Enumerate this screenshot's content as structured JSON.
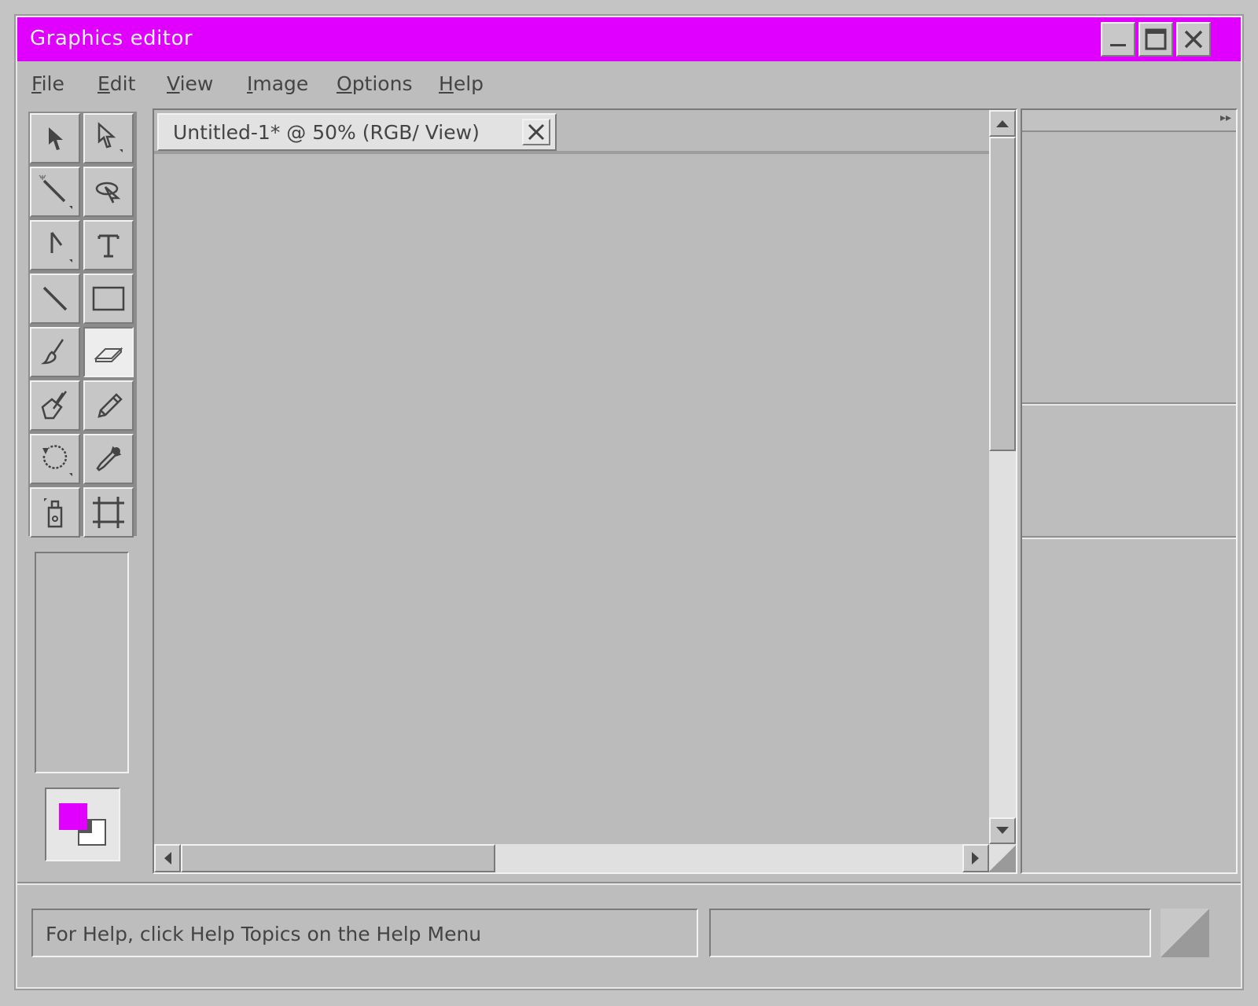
{
  "window": {
    "title": "Graphics editor",
    "title_bar_color": "#df00ff",
    "controls": [
      "minimize-icon",
      "maximize-icon",
      "close-icon"
    ]
  },
  "menu": {
    "items": [
      {
        "accel": "F",
        "rest": "ile"
      },
      {
        "accel": "E",
        "rest": "dit"
      },
      {
        "accel": "V",
        "rest": "iew"
      },
      {
        "accel": "I",
        "rest": "mage"
      },
      {
        "accel": "O",
        "rest": "ptions"
      },
      {
        "accel": "H",
        "rest": "elp"
      }
    ]
  },
  "toolbox": {
    "tools": [
      "selection-arrow-icon",
      "direct-selection-icon",
      "magic-wand-icon",
      "lasso-icon",
      "pen-icon",
      "text-icon",
      "line-icon",
      "rectangle-icon",
      "brush-icon",
      "eraser-icon",
      "paint-bucket-icon",
      "pencil-icon",
      "rotate-icon",
      "eyedropper-icon",
      "stamp-icon",
      "crop-icon"
    ],
    "active_tool": "eraser-icon",
    "foreground_color": "#df00ff",
    "background_color": "#ffffff"
  },
  "document": {
    "tab_label": "Untitled-1* @ 50% (RGB/ View)"
  },
  "status": {
    "help_text": "For Help, click Help Topics on the Help Menu",
    "secondary_text": ""
  }
}
